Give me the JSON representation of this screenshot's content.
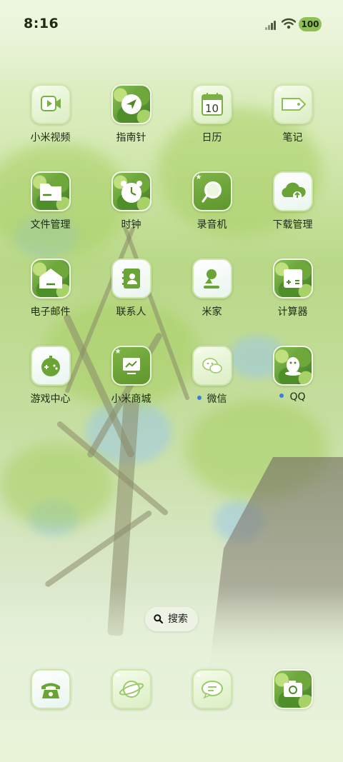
{
  "status_bar": {
    "time": "8:16",
    "battery": "100"
  },
  "apps": [
    {
      "label": "小米视频",
      "icon": "video-icon"
    },
    {
      "label": "指南针",
      "icon": "compass-icon"
    },
    {
      "label": "日历",
      "icon": "calendar-icon",
      "date": "10"
    },
    {
      "label": "笔记",
      "icon": "notes-icon"
    },
    {
      "label": "文件管理",
      "icon": "folder-icon"
    },
    {
      "label": "时钟",
      "icon": "clock-icon"
    },
    {
      "label": "录音机",
      "icon": "recorder-icon"
    },
    {
      "label": "下载管理",
      "icon": "download-icon"
    },
    {
      "label": "电子邮件",
      "icon": "mail-icon"
    },
    {
      "label": "联系人",
      "icon": "contacts-icon"
    },
    {
      "label": "米家",
      "icon": "mijia-icon"
    },
    {
      "label": "计算器",
      "icon": "calculator-icon"
    },
    {
      "label": "游戏中心",
      "icon": "game-icon"
    },
    {
      "label": "小米商城",
      "icon": "store-icon"
    },
    {
      "label": "微信",
      "icon": "wechat-icon"
    },
    {
      "label": "QQ",
      "icon": "qq-icon"
    }
  ],
  "search": {
    "label": "搜索"
  },
  "dock": [
    {
      "icon": "phone-icon"
    },
    {
      "icon": "browser-icon"
    },
    {
      "icon": "messages-icon"
    },
    {
      "icon": "camera-icon"
    }
  ],
  "colors": {
    "accent": "#6aa336",
    "notification_dot": "#3b7be0"
  }
}
